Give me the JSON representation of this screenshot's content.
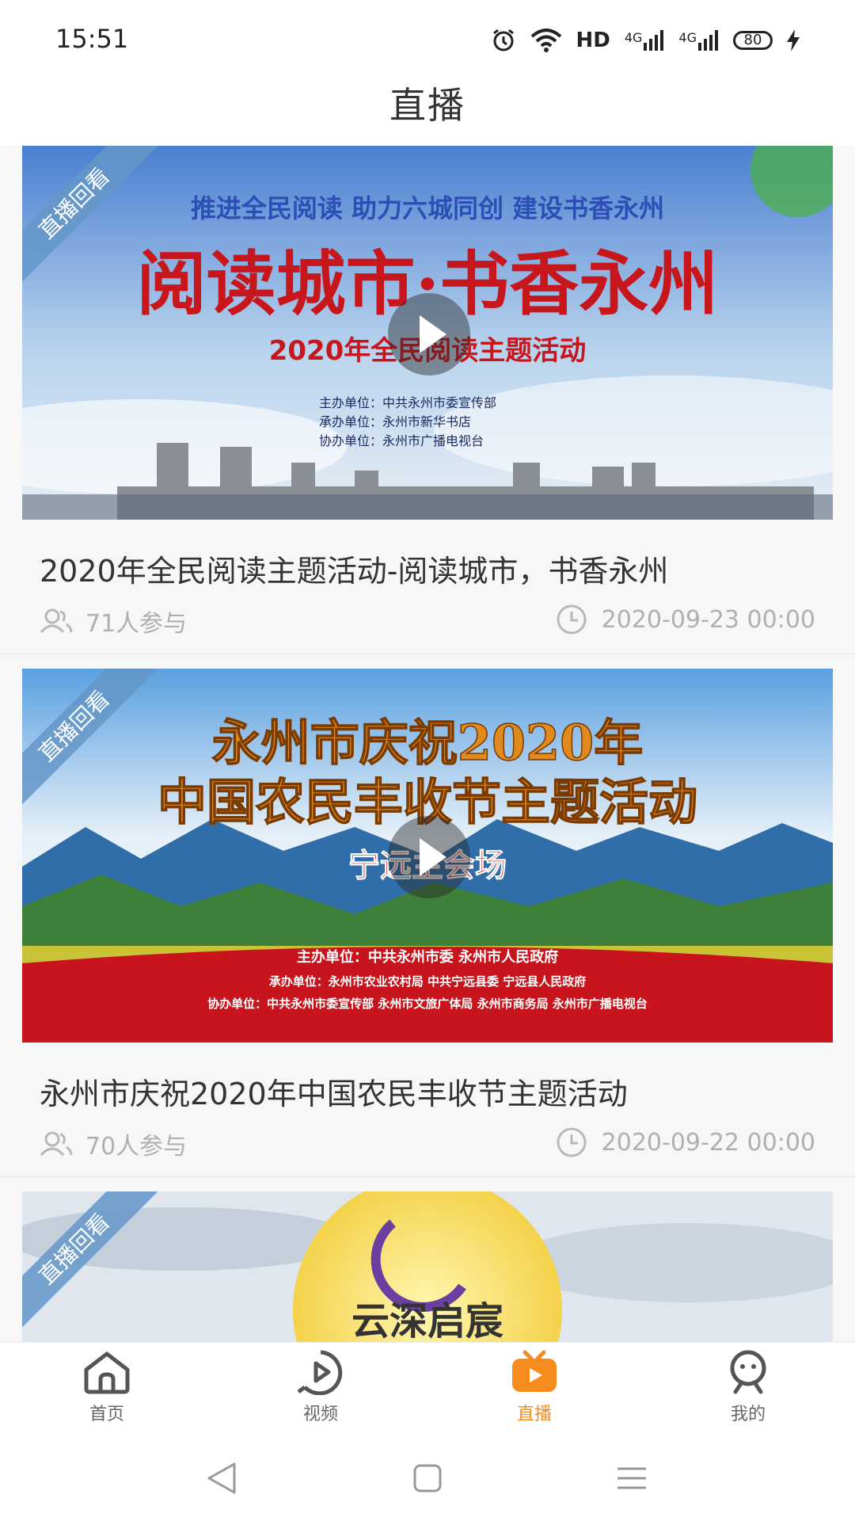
{
  "status": {
    "time": "15:51",
    "hd": "HD",
    "net1": "4G",
    "net2": "4G",
    "battery": "80"
  },
  "header": {
    "title": "直播"
  },
  "badge_label": "直播回看",
  "items": [
    {
      "title": "2020年全民阅读主题活动-阅读城市，书香永州",
      "participants": "71人参与",
      "date": "2020-09-23 00:00",
      "poster": {
        "top_line": "推进全民阅读 助力六城同创 建设书香永州",
        "headline": "阅读城市·书香永州",
        "subline": "2020年全民阅读主题活动",
        "credits": [
          "主办单位：中共永州市委宣传部",
          "承办单位：永州市新华书店",
          "协办单位：永州市广播电视台"
        ]
      }
    },
    {
      "title": "永州市庆祝2020年中国农民丰收节主题活动",
      "participants": "70人参与",
      "date": "2020-09-22 00:00",
      "poster": {
        "line1": "永州市庆祝2020年",
        "line2": "中国农民丰收节主题活动",
        "line3": "宁远主会场",
        "credits": [
          "主办单位：中共永州市委 永州市人民政府",
          "承办单位：永州市农业农村局 中共宁远县委 宁远县人民政府",
          "协办单位：中共永州市委宣传部 永州市文旅广体局 永州市商务局 永州市广播电视台"
        ]
      }
    },
    {
      "poster": {
        "text": "云深启宸"
      }
    }
  ],
  "tabs": [
    {
      "label": "首页"
    },
    {
      "label": "视频"
    },
    {
      "label": "直播"
    },
    {
      "label": "我的"
    }
  ],
  "colors": {
    "accent": "#f68c1e",
    "badge": "#6496c8",
    "text": "#333333",
    "meta": "#b0b0b0"
  }
}
